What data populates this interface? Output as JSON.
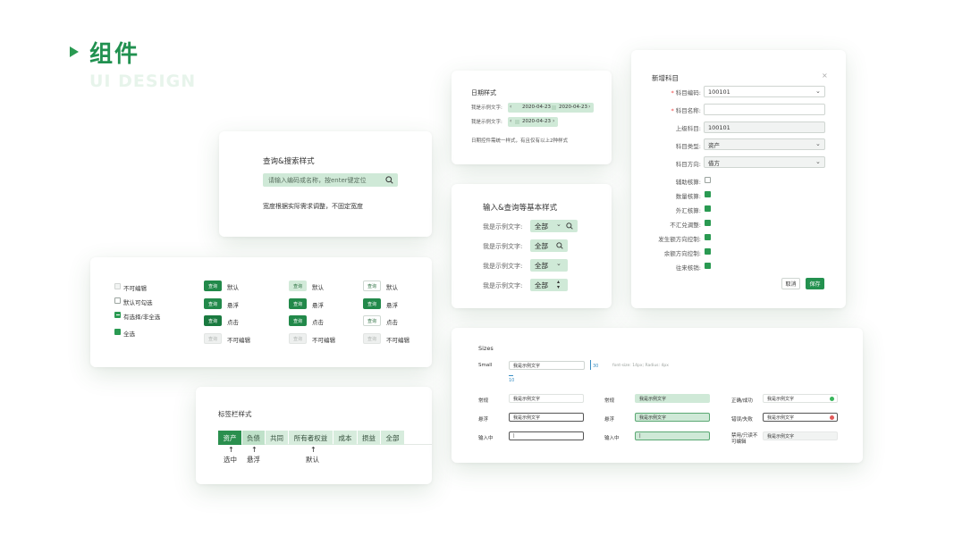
{
  "header": {
    "title": "组件",
    "subtitle": "UI DESIGN"
  },
  "date_card": {
    "title": "日期样式",
    "rows": [
      {
        "label": "我是示例文字:",
        "start": "2020-04-23",
        "end": "2020-04-23"
      },
      {
        "label": "我是示例文字:",
        "start": "2020-04-23"
      }
    ],
    "note": "日期控件需统一样式，有且仅有以上2种样式"
  },
  "search_card": {
    "title": "查询&搜索样式",
    "placeholder": "请输入编码或名称，按enter键定位",
    "note": "宽度根据实际需求调整，不固定宽度"
  },
  "input_card": {
    "title": "输入&查询等基本样式",
    "rows": [
      {
        "label": "我是示例文字:",
        "value": "全部"
      },
      {
        "label": "我是示例文字:",
        "value": "全部"
      },
      {
        "label": "我是示例文字:",
        "value": "全部"
      },
      {
        "label": "我是示例文字:",
        "value": "全部"
      }
    ]
  },
  "form_card": {
    "title": "新增科目",
    "fields": [
      {
        "label": "科目编码:",
        "value": "100101",
        "required": true
      },
      {
        "label": "科目名称:",
        "value": "",
        "required": true
      },
      {
        "label": "上级科目:",
        "value": "100101"
      },
      {
        "label": "科目类型:",
        "value": "资产"
      },
      {
        "label": "科目方向:",
        "value": "借方"
      }
    ],
    "checks": [
      {
        "label": "辅助核算:",
        "checked": false
      },
      {
        "label": "数量核算:",
        "checked": true
      },
      {
        "label": "外汇核算:",
        "checked": true
      },
      {
        "label": "不汇兑调整:",
        "checked": true
      },
      {
        "label": "发生额方向控制:",
        "checked": true
      },
      {
        "label": "余额方向控制:",
        "checked": true
      },
      {
        "label": "往来核销:",
        "checked": true
      }
    ],
    "cancel": "取消",
    "save": "保存"
  },
  "checkbox_card": {
    "checkboxes": [
      "不可编辑",
      "默认可勾选",
      "有选择/非全选",
      "全选"
    ],
    "button_text": "查询",
    "states": [
      "默认",
      "悬浮",
      "点击",
      "不可编辑"
    ]
  },
  "tabs_card": {
    "title": "标签栏样式",
    "tabs": [
      "资产",
      "负债",
      "共同",
      "所有者权益",
      "成本",
      "损益",
      "全部"
    ],
    "annotations": [
      "选中",
      "悬浮",
      "默认"
    ]
  },
  "sizes_card": {
    "title": "Sizes",
    "small_label": "Small",
    "sample": "我是示例文字",
    "dim_w": "30",
    "dim_h": "10",
    "spec": "font-size: 14px; Radius: 4px",
    "col1": [
      "常规",
      "悬浮",
      "输入中"
    ],
    "col2": [
      "常规",
      "悬浮",
      "输入中"
    ],
    "col3": [
      "正确/成功",
      "错误/失败",
      "禁用/只读不可编辑"
    ],
    "cursor": "|"
  },
  "colors": {
    "primary": "#2a9a52",
    "light": "#cfe9d7",
    "error": "#e05a5a"
  }
}
